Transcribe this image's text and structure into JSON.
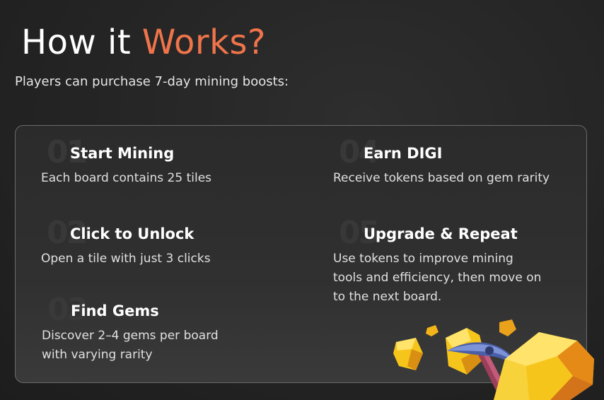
{
  "title": {
    "prefix": "How it ",
    "accent": "Works?"
  },
  "subtitle": "Players can purchase 7-day mining boosts:",
  "steps": [
    {
      "number": "01",
      "heading": "Start Mining",
      "description": "Each board contains 25 tiles"
    },
    {
      "number": "02",
      "heading": "Click to Unlock",
      "description": "Open a tile with just 3 clicks"
    },
    {
      "number": "03",
      "heading": "Find Gems",
      "description": "Discover 2–4 gems per board with varying rarity"
    },
    {
      "number": "04",
      "heading": "Earn DIGI",
      "description": "Receive tokens based on gem rarity"
    },
    {
      "number": "05",
      "heading": "Upgrade & Repeat",
      "description": "Use tokens to improve mining tools and efficiency, then move on to the next board."
    }
  ],
  "colors": {
    "accent": "#f0744a",
    "background": "#262626",
    "gold": "#f5c21b"
  },
  "icons": {
    "illustration": "pickaxe-gold-icon"
  }
}
